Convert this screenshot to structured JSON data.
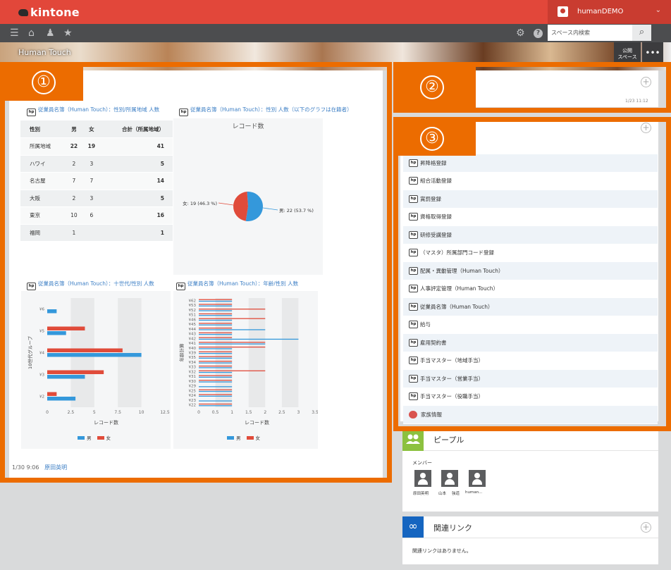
{
  "header": {
    "logo": "kintone",
    "user_name": "humanDEMO",
    "search_placeholder": "スペース内検索",
    "space_name": "Human Touch",
    "space_btn": "公開\nスペース",
    "more": "•••"
  },
  "icons": {
    "menu": "menu-icon",
    "home": "home-icon",
    "bell": "bell-icon",
    "star": "star-icon",
    "gear": "gear-icon",
    "help": "help-icon",
    "search": "search-icon"
  },
  "main": {
    "table_title": "従業員名簿（Human Touch）：性別/所属地域 人数",
    "pie_title": "従業員名簿（Human Touch）：性別 人数（以下のグラフは在籍者）",
    "bar1_title": "従業員名簿（Human Touch）：十世代/性別 人数",
    "bar2_title": "従業員名簿（Human Touch）：年齢/性別 人数",
    "footer_date": "1/30 9:06",
    "footer_author": "原田英明"
  },
  "table": {
    "headers": [
      "性別",
      "男",
      "女",
      "合計（所属地域）"
    ],
    "rows": [
      [
        "所属地域",
        "22",
        "19",
        "41"
      ],
      [
        "ハワイ",
        "2",
        "3",
        "5"
      ],
      [
        "名古屋",
        "7",
        "7",
        "14"
      ],
      [
        "大阪",
        "2",
        "3",
        "5"
      ],
      [
        "東京",
        "10",
        "6",
        "16"
      ],
      [
        "福岡",
        "1",
        "",
        "1"
      ]
    ]
  },
  "chart_data": [
    {
      "type": "pie",
      "title": "レコード数",
      "labels": [
        "男",
        "女"
      ],
      "values": [
        22,
        19
      ],
      "data_labels": [
        "男: 22 (53.7 %)",
        "女: 19 (46.3 %)"
      ],
      "colors": [
        "#3498db",
        "#e04b3a"
      ]
    },
    {
      "type": "bar",
      "orientation": "horizontal",
      "categories": [
        "¥6",
        "¥5",
        "¥4",
        "¥3",
        "¥2"
      ],
      "series": [
        {
          "name": "男",
          "values": [
            1,
            2,
            10,
            4,
            3
          ]
        },
        {
          "name": "女",
          "values": [
            0,
            4,
            8,
            6,
            1
          ]
        }
      ],
      "xlabel": "レコード数",
      "ylabel": "10世代グループ",
      "xlim": [
        0,
        12.5
      ],
      "xticks": [
        "0",
        "2.5",
        "5",
        "7.5",
        "10",
        "12.5"
      ],
      "legend": "bottom"
    },
    {
      "type": "bar",
      "orientation": "horizontal",
      "categories": [
        "¥62",
        "¥53",
        "¥52",
        "¥51",
        "¥46",
        "¥45",
        "¥44",
        "¥43",
        "¥42",
        "¥41",
        "¥40",
        "¥39",
        "¥35",
        "¥34",
        "¥33",
        "¥32",
        "¥31",
        "¥30",
        "¥29",
        "¥25",
        "¥24",
        "¥23",
        "¥22"
      ],
      "series": [
        {
          "name": "男",
          "values": [
            1,
            1,
            1,
            1,
            1,
            1,
            2,
            1,
            3,
            2,
            1,
            1,
            1,
            1,
            1,
            1,
            1,
            1,
            1,
            1,
            1,
            1,
            1
          ]
        },
        {
          "name": "女",
          "values": [
            1,
            1,
            2,
            1,
            2,
            1,
            1,
            1,
            1,
            2,
            2,
            1,
            1,
            1,
            1,
            2,
            1,
            1,
            0,
            1,
            1,
            0,
            1
          ]
        }
      ],
      "xlabel": "レコード数",
      "ylabel": "年齢計算",
      "xlim": [
        0,
        3.5
      ],
      "xticks": [
        "0",
        "0.5",
        "1",
        "1.5",
        "2",
        "2.5",
        "3",
        "3.5"
      ],
      "legend": "bottom"
    }
  ],
  "legend": {
    "male": "男",
    "female": "女"
  },
  "side": {
    "apps": [
      {
        "icon": "hp",
        "label": "昇降格登録"
      },
      {
        "icon": "hp",
        "label": "組合活動登録"
      },
      {
        "icon": "hp",
        "label": "賞罰登録"
      },
      {
        "icon": "hp",
        "label": "資格取得登録"
      },
      {
        "icon": "hp",
        "label": "研修受講登録"
      },
      {
        "icon": "hp",
        "label": "（マスタ）所属部門コード登録"
      },
      {
        "icon": "hp",
        "label": "配属・異動管理（Human Touch）"
      },
      {
        "icon": "hp",
        "label": "人事評定管理（Human Touch）"
      },
      {
        "icon": "hp",
        "label": "従業員名簿（Human Touch）"
      },
      {
        "icon": "hp",
        "label": "給与"
      },
      {
        "icon": "hp",
        "label": "雇用契約書"
      },
      {
        "icon": "hp",
        "label": "手当マスター（地域手当）"
      },
      {
        "icon": "hp",
        "label": "手当マスター（営業手当）"
      },
      {
        "icon": "hp",
        "label": "手当マスター（役職手当）"
      },
      {
        "icon": "family",
        "label": "家族情報"
      }
    ],
    "people_title": "ピープル",
    "members_label": "メンバー",
    "members": [
      "原田英明",
      "山本",
      "強道",
      "human..."
    ],
    "links_title": "関連リンク",
    "links_empty": "関連リンクはありません。",
    "post_date": "1/23 11:12"
  },
  "callouts": [
    "①",
    "②",
    "③"
  ],
  "colors": {
    "header": "#e2473a",
    "nav": "#4c4d4f",
    "callout": "#ec6c00",
    "male": "#3498db",
    "female": "#e04b3a"
  }
}
